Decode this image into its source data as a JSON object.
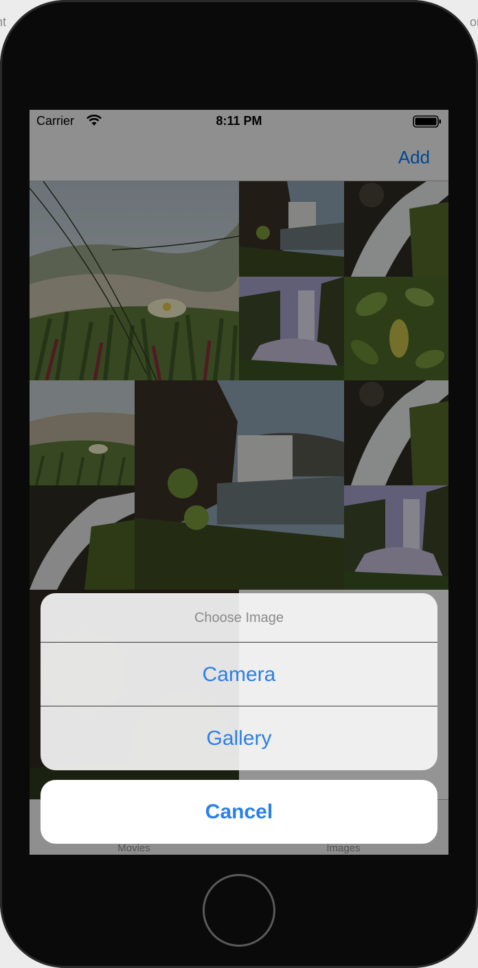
{
  "status_bar": {
    "carrier": "Carrier",
    "time": "8:11 PM"
  },
  "nav_bar": {
    "add_label": "Add"
  },
  "tab_bar": {
    "tabs": [
      {
        "label": "Movies"
      },
      {
        "label": "Images"
      }
    ]
  },
  "action_sheet": {
    "title": "Choose Image",
    "options": [
      {
        "label": "Camera"
      },
      {
        "label": "Gallery"
      }
    ],
    "cancel_label": "Cancel"
  },
  "colors": {
    "accent": "#2a7fe8",
    "sheet_background": "#f6f6f6"
  },
  "grid": {
    "photos": [
      {
        "subject": "meadow-flower"
      },
      {
        "subject": "waterfall-cliff"
      },
      {
        "subject": "waterfall-closeup"
      },
      {
        "subject": "waterfall-valley"
      },
      {
        "subject": "leaves"
      },
      {
        "subject": "meadow-flower"
      },
      {
        "subject": "waterfall-cliff"
      },
      {
        "subject": "waterfall-closeup"
      },
      {
        "subject": "waterfall-closeup"
      },
      {
        "subject": "waterfall-valley"
      },
      {
        "subject": "dark-rocks"
      }
    ]
  }
}
